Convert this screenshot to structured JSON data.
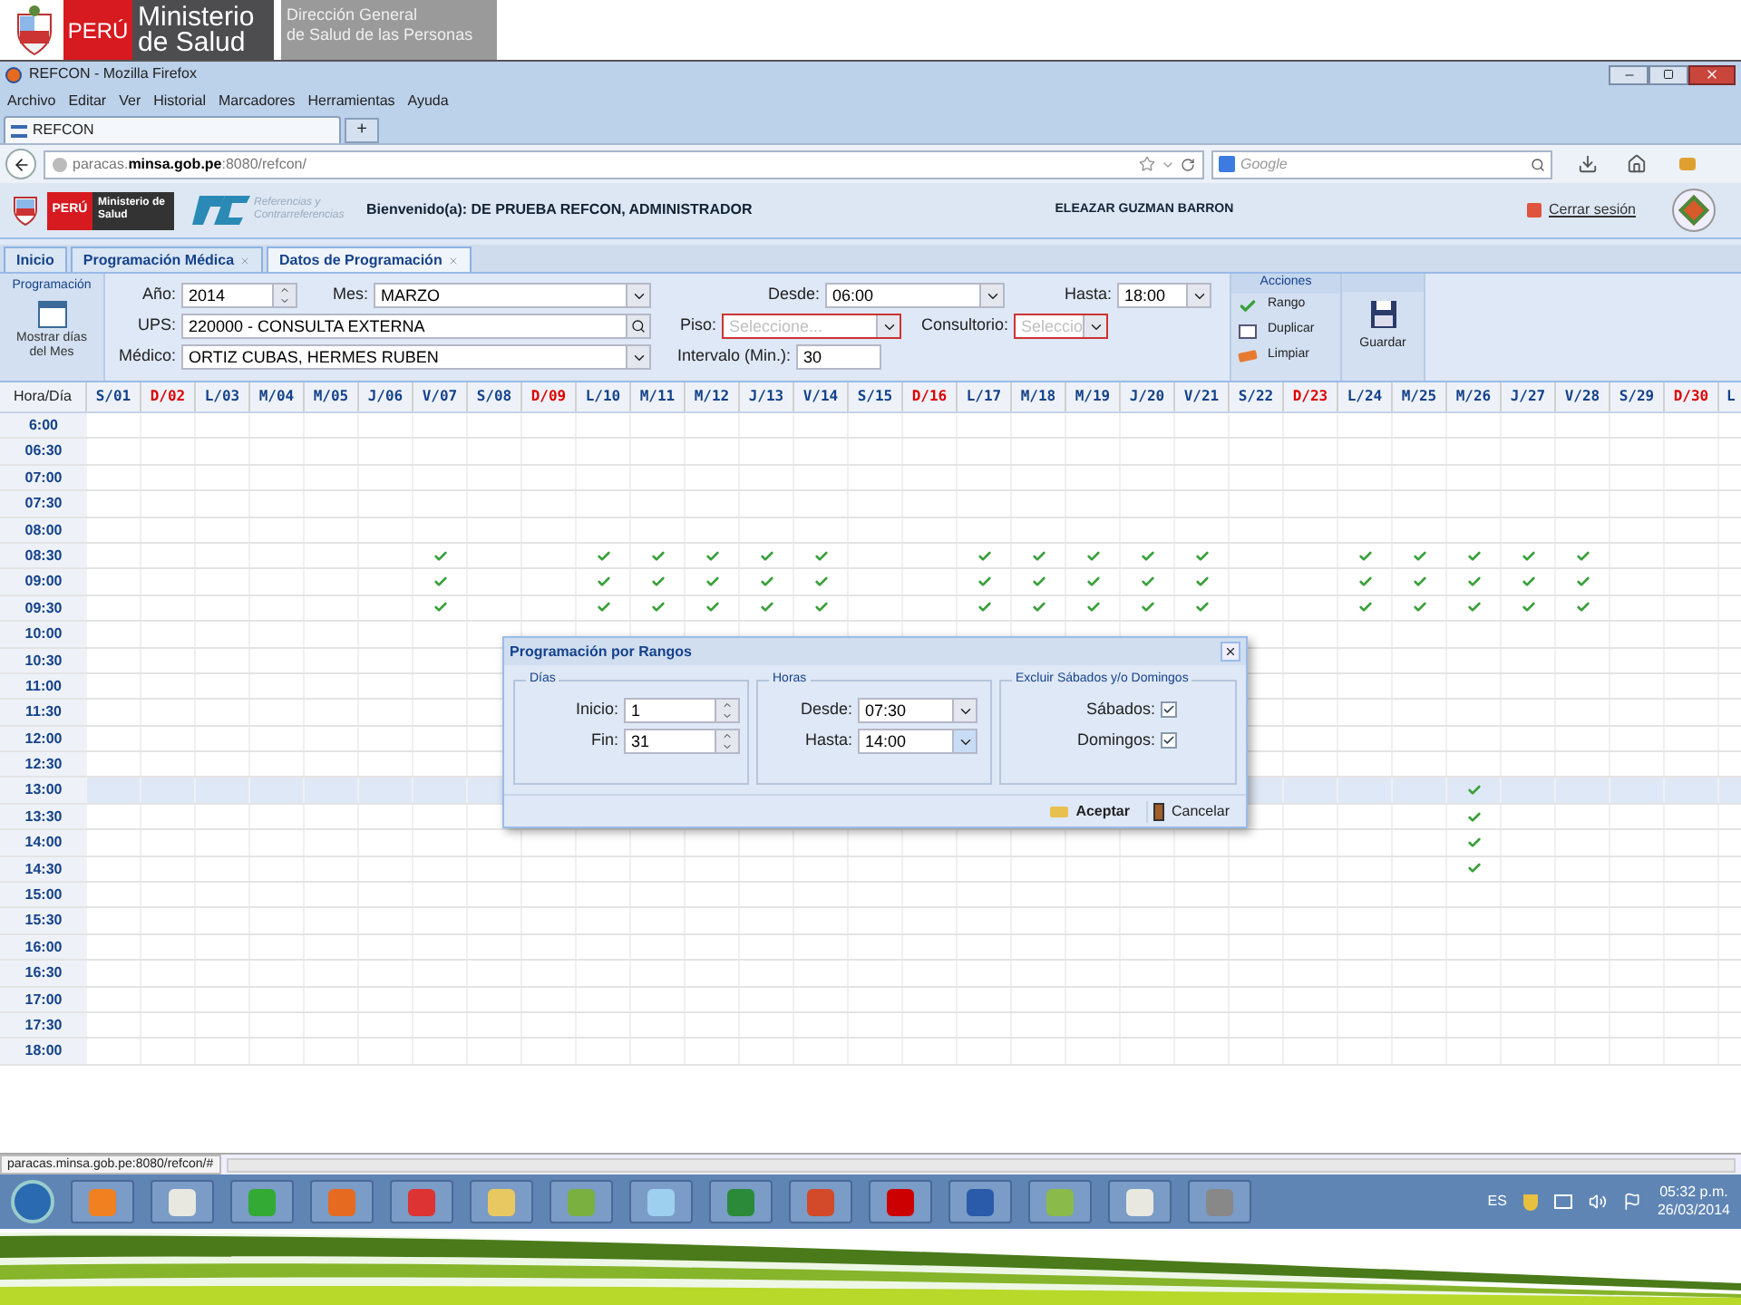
{
  "slide_banner": {
    "country": "PERÚ",
    "ministry_line1": "Ministerio",
    "ministry_line2": "de Salud",
    "office_line1": "Dirección General",
    "office_line2": "de Salud de las Personas"
  },
  "browser": {
    "title": "REFCON - Mozilla Firefox",
    "menu": [
      "Archivo",
      "Editar",
      "Ver",
      "Historial",
      "Marcadores",
      "Herramientas",
      "Ayuda"
    ],
    "tabs": [
      {
        "label": "REFCON",
        "selected": true
      }
    ],
    "new_tab": "+",
    "url_host": "paracas.",
    "url_domain": "minsa.gob.pe",
    "url_rest": ":8080/refcon/",
    "search_placeholder": "Google",
    "status_url": "paracas.minsa.gob.pe:8080/refcon/#"
  },
  "app_header": {
    "logo_country": "PERÚ",
    "logo_ministry": "Ministerio de Salud",
    "logo_rc_sub": "Referencias y Contrarreferencias",
    "welcome": "Bienvenido(a): DE PRUEBA REFCON, ADMINISTRADOR",
    "user": "ELEAZAR GUZMAN BARRON",
    "logout": "Cerrar sesión"
  },
  "app_tabs": [
    {
      "label": "Inicio",
      "selected": false,
      "closable": false
    },
    {
      "label": "Programación Médica",
      "selected": false,
      "closable": true
    },
    {
      "label": "Datos de Programación",
      "selected": true,
      "closable": true
    }
  ],
  "form": {
    "group_title": "Programación",
    "show_days": "Mostrar días del Mes",
    "anio": {
      "label": "Año:",
      "value": "2014",
      "kind": "spinner"
    },
    "mes": {
      "label": "Mes:",
      "value": "MARZO",
      "kind": "combo"
    },
    "desde": {
      "label": "Desde:",
      "value": "06:00",
      "kind": "combo"
    },
    "hasta": {
      "label": "Hasta:",
      "value": "18:00",
      "kind": "combo"
    },
    "ups": {
      "label": "UPS:",
      "value": "220000 - CONSULTA EXTERNA",
      "kind": "search"
    },
    "piso": {
      "label": "Piso:",
      "placeholder": "Seleccione...",
      "kind": "combo",
      "invalid": true
    },
    "consultorio": {
      "label": "Consultorio:",
      "placeholder": "Seleccio",
      "kind": "combo",
      "invalid": true
    },
    "medico": {
      "label": "Médico:",
      "value": "ORTIZ CUBAS, HERMES RUBEN",
      "kind": "combo"
    },
    "intervalo": {
      "label": "Intervalo (Min.):",
      "value": "30"
    }
  },
  "actions": {
    "title": "Acciones",
    "items": [
      {
        "label": "Rango",
        "kind": "check"
      },
      {
        "label": "Duplicar",
        "kind": "copy"
      },
      {
        "label": "Limpiar",
        "kind": "eraser"
      }
    ],
    "save": "Guardar"
  },
  "grid": {
    "corner": "Hora/Día",
    "columns": [
      {
        "label": "S/01",
        "sunday": false
      },
      {
        "label": "D/02",
        "sunday": true
      },
      {
        "label": "L/03",
        "sunday": false
      },
      {
        "label": "M/04",
        "sunday": false
      },
      {
        "label": "M/05",
        "sunday": false
      },
      {
        "label": "J/06",
        "sunday": false
      },
      {
        "label": "V/07",
        "sunday": false
      },
      {
        "label": "S/08",
        "sunday": false
      },
      {
        "label": "D/09",
        "sunday": true
      },
      {
        "label": "L/10",
        "sunday": false
      },
      {
        "label": "M/11",
        "sunday": false
      },
      {
        "label": "M/12",
        "sunday": false
      },
      {
        "label": "J/13",
        "sunday": false
      },
      {
        "label": "V/14",
        "sunday": false
      },
      {
        "label": "S/15",
        "sunday": false
      },
      {
        "label": "D/16",
        "sunday": true
      },
      {
        "label": "L/17",
        "sunday": false
      },
      {
        "label": "M/18",
        "sunday": false
      },
      {
        "label": "M/19",
        "sunday": false
      },
      {
        "label": "J/20",
        "sunday": false
      },
      {
        "label": "V/21",
        "sunday": false
      },
      {
        "label": "S/22",
        "sunday": false
      },
      {
        "label": "D/23",
        "sunday": true
      },
      {
        "label": "L/24",
        "sunday": false
      },
      {
        "label": "M/25",
        "sunday": false
      },
      {
        "label": "M/26",
        "sunday": false
      },
      {
        "label": "J/27",
        "sunday": false
      },
      {
        "label": "V/28",
        "sunday": false
      },
      {
        "label": "S/29",
        "sunday": false
      },
      {
        "label": "D/30",
        "sunday": true
      },
      {
        "label": "L",
        "sunday": false
      }
    ],
    "rows": [
      {
        "time": "6:00",
        "selected": false
      },
      {
        "time": "06:30",
        "selected": false
      },
      {
        "time": "07:00",
        "selected": false
      },
      {
        "time": "07:30",
        "selected": false
      },
      {
        "time": "08:00",
        "selected": false
      },
      {
        "time": "08:30",
        "selected": false,
        "cells": [
          false,
          false,
          false,
          false,
          false,
          false,
          true,
          false,
          false,
          true,
          true,
          true,
          true,
          true,
          false,
          false,
          true,
          true,
          true,
          true,
          true,
          false,
          false,
          true,
          true,
          true,
          true,
          true,
          false,
          false
        ]
      },
      {
        "time": "09:00",
        "selected": false,
        "cells": [
          false,
          false,
          false,
          false,
          false,
          false,
          true,
          false,
          false,
          true,
          true,
          true,
          true,
          true,
          false,
          false,
          true,
          true,
          true,
          true,
          true,
          false,
          false,
          true,
          true,
          true,
          true,
          true,
          false,
          false
        ]
      },
      {
        "time": "09:30",
        "selected": false,
        "cells": [
          false,
          false,
          false,
          false,
          false,
          false,
          true,
          false,
          false,
          true,
          true,
          true,
          true,
          true,
          false,
          false,
          true,
          true,
          true,
          true,
          true,
          false,
          false,
          true,
          true,
          true,
          true,
          true,
          false,
          false
        ]
      },
      {
        "time": "10:00",
        "selected": false
      },
      {
        "time": "10:30",
        "selected": false
      },
      {
        "time": "11:00",
        "selected": false
      },
      {
        "time": "11:30",
        "selected": false
      },
      {
        "time": "12:00",
        "selected": false
      },
      {
        "time": "12:30",
        "selected": false
      },
      {
        "time": "13:00",
        "selected": true,
        "cells": [
          false,
          false,
          false,
          false,
          false,
          false,
          false,
          false,
          null,
          null,
          null,
          null,
          null,
          null,
          null,
          null,
          null,
          null,
          null,
          null,
          null,
          false,
          false,
          false,
          false,
          true,
          false,
          false,
          false,
          false
        ]
      },
      {
        "time": "13:30",
        "selected": false,
        "cells": [
          false,
          false,
          false,
          false,
          false,
          false,
          false,
          false,
          null,
          null,
          null,
          null,
          null,
          null,
          null,
          null,
          null,
          null,
          null,
          null,
          null,
          false,
          false,
          false,
          false,
          true,
          false,
          false,
          false,
          false
        ]
      },
      {
        "time": "14:00",
        "selected": false,
        "cells": [
          false,
          false,
          false,
          false,
          false,
          false,
          false,
          false,
          null,
          null,
          null,
          null,
          null,
          null,
          null,
          null,
          null,
          null,
          null,
          null,
          null,
          false,
          false,
          false,
          false,
          true,
          false,
          false,
          false,
          false
        ]
      },
      {
        "time": "14:30",
        "selected": false,
        "cells": [
          false,
          false,
          false,
          false,
          false,
          false,
          false,
          false,
          false,
          false,
          false,
          false,
          false,
          false,
          false,
          false,
          false,
          false,
          false,
          false,
          false,
          false,
          false,
          false,
          false,
          true,
          false,
          false,
          false,
          false
        ]
      },
      {
        "time": "15:00",
        "selected": false
      },
      {
        "time": "15:30",
        "selected": false
      },
      {
        "time": "16:00",
        "selected": false
      },
      {
        "time": "16:30",
        "selected": false
      },
      {
        "time": "17:00",
        "selected": false
      },
      {
        "time": "17:30",
        "selected": false
      },
      {
        "time": "18:00",
        "selected": false
      }
    ]
  },
  "dialog": {
    "title": "Programación por Rangos",
    "dias": {
      "legend": "Días",
      "inicio": {
        "label": "Inicio:",
        "value": "1"
      },
      "fin": {
        "label": "Fin:",
        "value": "31"
      }
    },
    "horas": {
      "legend": "Horas",
      "desde": {
        "label": "Desde:",
        "value": "07:30",
        "focused": false
      },
      "hasta": {
        "label": "Hasta:",
        "value": "14:00",
        "focused": true
      }
    },
    "excluir": {
      "legend": "Excluir Sábados y/o Domingos",
      "items": [
        {
          "label": "Sábados:",
          "checked": true
        },
        {
          "label": "Domingos:",
          "checked": true
        }
      ]
    },
    "accept": "Aceptar",
    "cancel": "Cancelar"
  },
  "taskbar": {
    "lang": "ES",
    "time": "05:32 p.m.",
    "date": "26/03/2014"
  }
}
